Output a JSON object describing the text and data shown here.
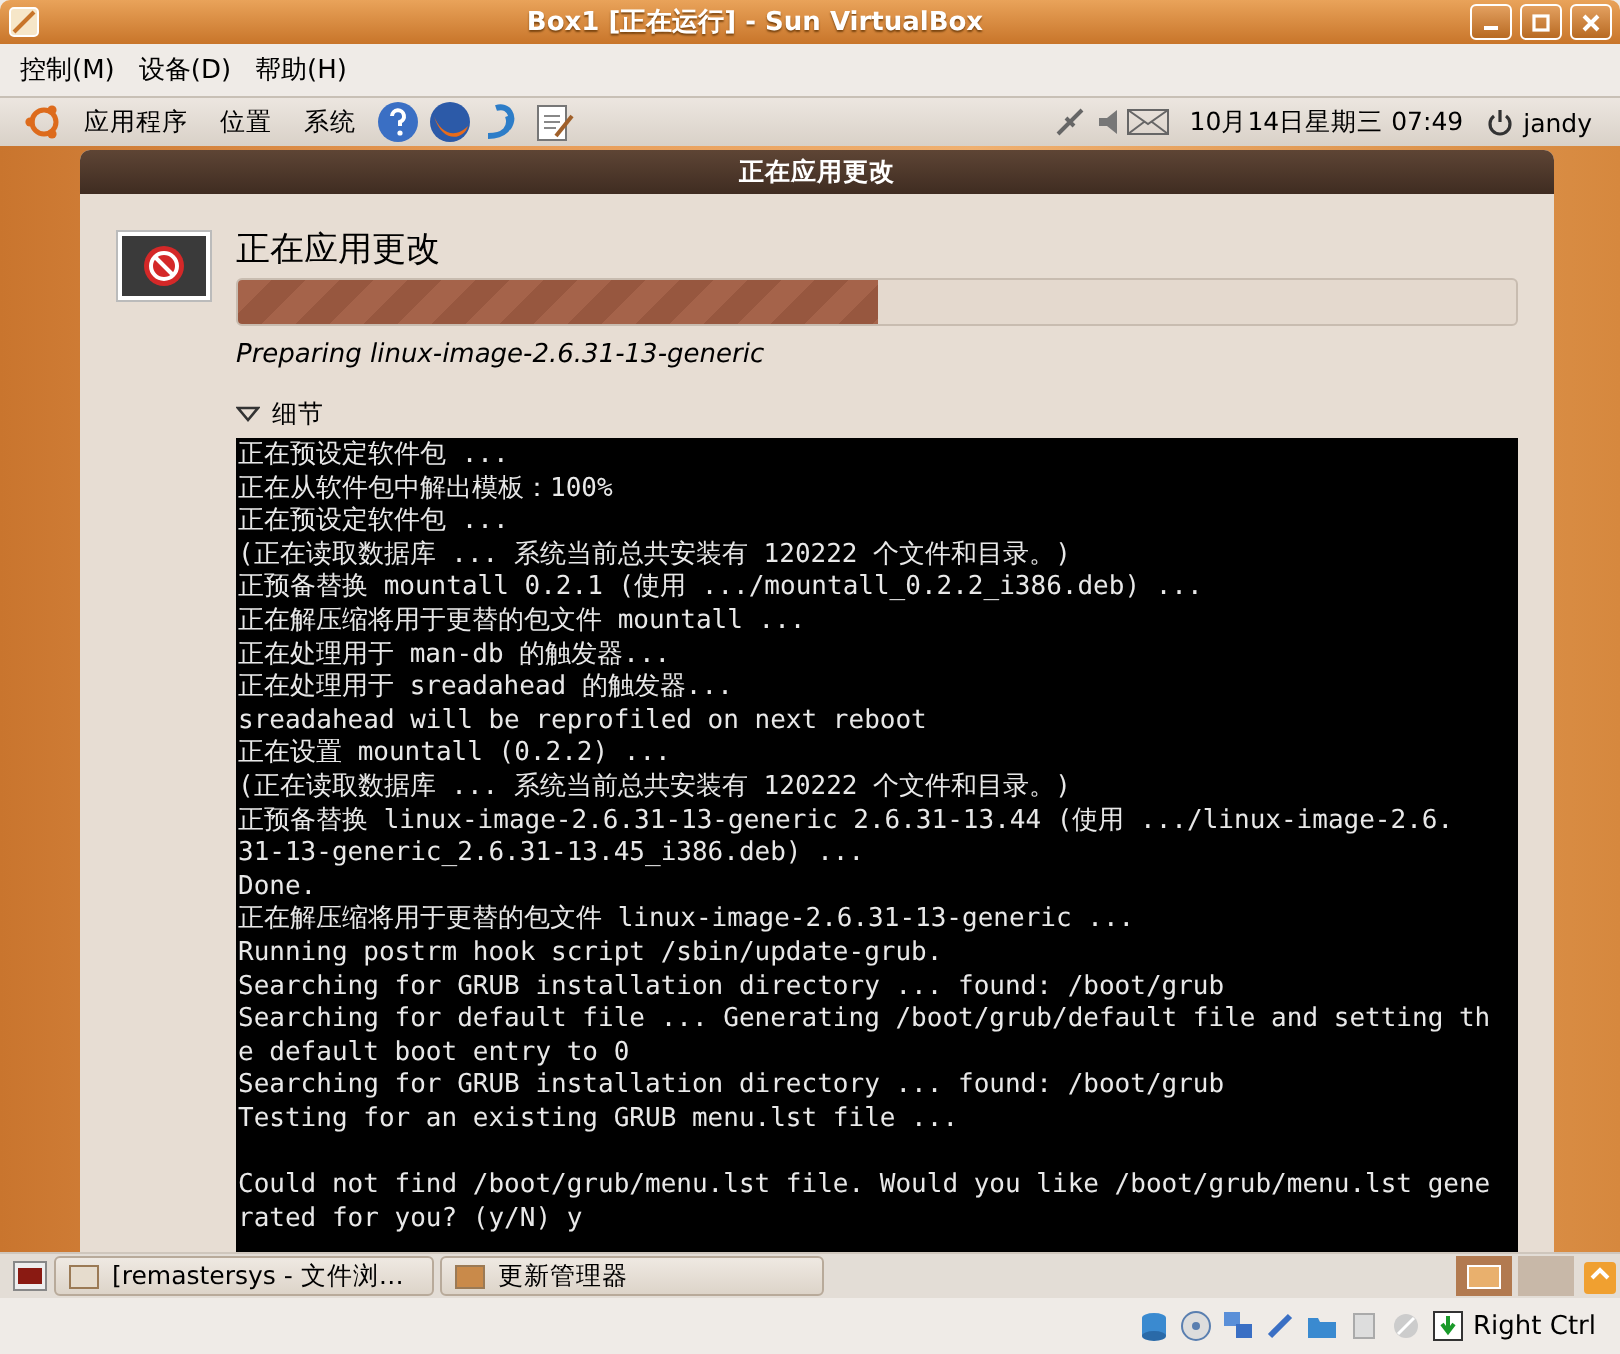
{
  "window": {
    "title": "Box1 [正在运行] - Sun VirtualBox"
  },
  "menu": [
    "控制(M)",
    "设备(D)",
    "帮助(H)"
  ],
  "guest_panel": {
    "menus": [
      "应用程序",
      "位置",
      "系统"
    ],
    "clock": "10月14日星期三 07:49",
    "user": "jandy"
  },
  "dialog": {
    "title": "正在应用更改",
    "heading": "正在应用更改",
    "progress": {
      "level": 0.5
    },
    "status": "Preparing linux-image-2.6.31-13-generic",
    "details": {
      "label": "细节",
      "expanded": true
    },
    "terminal": [
      [
        "正在预设定软件包 ...",
        "正在从软件包中解出模板：100%",
        "正在预设定软件包 ...",
        "(正在读取数据库 ... 系统当前总共安装有 120222 个文件和目录。)",
        "正预备替换 mountall 0.2.1 (使用 .../mountall_0.2.2_i386.deb) ...",
        "正在解压缩将用于更替的包文件 mountall ...",
        "正在处理用于 man-db 的触发器...",
        "正在处理用于 sreadahead 的触发器...",
        "sreadahead will be reprofiled on next reboot",
        "正在设置 mountall (0.2.2) ...",
        "(正在读取数据库 ... 系统当前总共安装有 120222 个文件和目录。)",
        "正预备替换 linux-image-2.6.31-13-generic 2.6.31-13.44 (使用 .../linux-image-2.6.",
        "31-13-generic_2.6.31-13.45_i386.deb) ...",
        "Done.",
        "正在解压缩将用于更替的包文件 linux-image-2.6.31-13-generic ...",
        "Running postrm hook script /sbin/update-grub.",
        "Searching for GRUB installation directory ... found: /boot/grub",
        "Searching for default file ... Generating /boot/grub/default file and setting th",
        "e default boot entry to 0",
        "Searching for GRUB installation directory ... found: /boot/grub",
        "Testing for an existing GRUB menu.lst file ..."
      ],
      [
        "Could not find /boot/grub/menu.lst file. Would you like /boot/grub/menu.lst gene",
        "rated for you? (y/N) y"
      ]
    ]
  },
  "taskbar": [
    {
      "label": "[remastersys - 文件浏…",
      "selected": false
    },
    {
      "label": "更新管理器",
      "selected": false
    }
  ],
  "status_bar": {
    "host_key": "Right Ctrl"
  }
}
